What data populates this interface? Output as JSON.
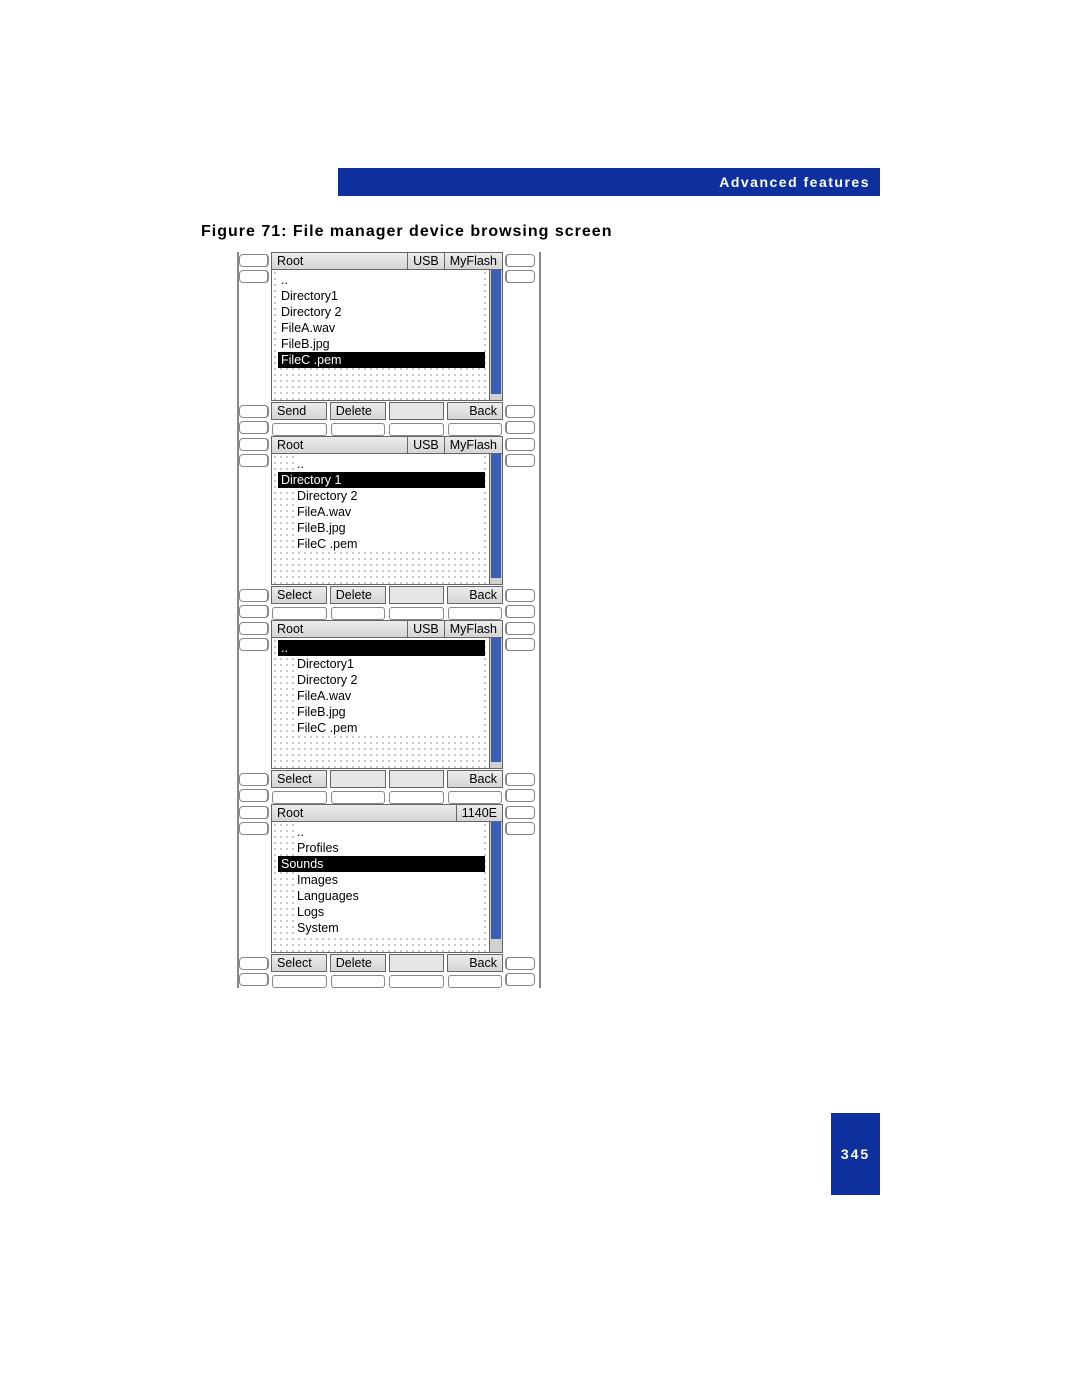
{
  "header": {
    "section_title": "Advanced features"
  },
  "caption": {
    "text": "Figure 71: File manager device browsing screen"
  },
  "page": {
    "number": "345"
  },
  "screens": [
    {
      "crumbs": [
        "Root",
        "USB",
        "MyFlash"
      ],
      "items": [
        {
          "label": "..",
          "selected": false,
          "indent": false
        },
        {
          "label": "Directory1",
          "selected": false,
          "indent": false
        },
        {
          "label": "Directory 2",
          "selected": false,
          "indent": false
        },
        {
          "label": "FileA.wav",
          "selected": false,
          "indent": false
        },
        {
          "label": "FileB.jpg",
          "selected": false,
          "indent": false
        },
        {
          "label": "FileC .pem",
          "selected": true,
          "indent": false,
          "wide": true
        }
      ],
      "scroll_thumb": {
        "top_pct": 0,
        "height_pct": 95
      },
      "softkeys": [
        "Send",
        "Delete",
        "",
        "Back"
      ]
    },
    {
      "crumbs": [
        "Root",
        "USB",
        "MyFlash"
      ],
      "items": [
        {
          "label": "..",
          "selected": false,
          "indent": true
        },
        {
          "label": "Directory 1",
          "selected": true,
          "indent": true,
          "wide": true
        },
        {
          "label": "Directory 2",
          "selected": false,
          "indent": true
        },
        {
          "label": "FileA.wav",
          "selected": false,
          "indent": true
        },
        {
          "label": "FileB.jpg",
          "selected": false,
          "indent": true
        },
        {
          "label": "FileC .pem",
          "selected": false,
          "indent": true
        }
      ],
      "scroll_thumb": {
        "top_pct": 0,
        "height_pct": 95
      },
      "softkeys": [
        "Select",
        "Delete",
        "",
        "Back"
      ]
    },
    {
      "crumbs": [
        "Root",
        "USB",
        "MyFlash"
      ],
      "items": [
        {
          "label": "..",
          "selected": true,
          "indent": false,
          "wide": true
        },
        {
          "label": "Directory1",
          "selected": false,
          "indent": true
        },
        {
          "label": "Directory 2",
          "selected": false,
          "indent": true
        },
        {
          "label": "FileA.wav",
          "selected": false,
          "indent": true
        },
        {
          "label": "FileB.jpg",
          "selected": false,
          "indent": true
        },
        {
          "label": "FileC .pem",
          "selected": false,
          "indent": true
        }
      ],
      "scroll_thumb": {
        "top_pct": 0,
        "height_pct": 95
      },
      "softkeys": [
        "Select",
        "",
        "",
        "Back"
      ]
    },
    {
      "crumbs": [
        "Root",
        "1140E"
      ],
      "items": [
        {
          "label": "..",
          "selected": false,
          "indent": true
        },
        {
          "label": "Profiles",
          "selected": false,
          "indent": true
        },
        {
          "label": "Sounds",
          "selected": true,
          "indent": true,
          "wide": true
        },
        {
          "label": "Images",
          "selected": false,
          "indent": true
        },
        {
          "label": "Languages",
          "selected": false,
          "indent": true
        },
        {
          "label": "Logs",
          "selected": false,
          "indent": true
        },
        {
          "label": "System",
          "selected": false,
          "indent": true
        }
      ],
      "scroll_thumb": {
        "top_pct": 0,
        "height_pct": 90
      },
      "softkeys": [
        "Select",
        "Delete",
        "",
        "Back"
      ]
    }
  ]
}
